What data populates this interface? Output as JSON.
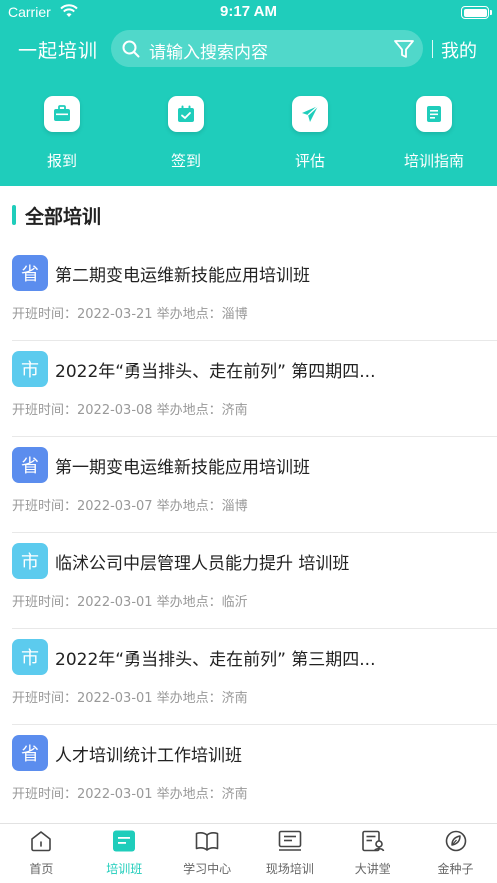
{
  "status_bar": {
    "carrier": "Carrier",
    "time": "9:17 AM"
  },
  "header": {
    "app_title": "一起培训",
    "search_placeholder": "请输入搜索内容",
    "mine_label": "我的"
  },
  "quick_actions": [
    {
      "label": "报到",
      "icon": "briefcase-icon"
    },
    {
      "label": "签到",
      "icon": "calendar-check-icon"
    },
    {
      "label": "评估",
      "icon": "paper-plane-icon"
    },
    {
      "label": "培训指南",
      "icon": "document-icon"
    }
  ],
  "section": {
    "title": "全部培训"
  },
  "trainings": [
    {
      "level": "省",
      "level_type": "province",
      "title": "第二期变电运维新技能应用培训班",
      "meta": "开班时间：2022-03-21 举办地点：淄博"
    },
    {
      "level": "市",
      "level_type": "city",
      "title": "2022年“勇当排头、走在前列” 第四期四...",
      "meta": "开班时间：2022-03-08 举办地点：济南"
    },
    {
      "level": "省",
      "level_type": "province",
      "title": "第一期变电运维新技能应用培训班",
      "meta": "开班时间：2022-03-07 举办地点：淄博"
    },
    {
      "level": "市",
      "level_type": "city",
      "title": "临沭公司中层管理人员能力提升 培训班",
      "meta": "开班时间：2022-03-01 举办地点：临沂"
    },
    {
      "level": "市",
      "level_type": "city",
      "title": "2022年“勇当排头、走在前列” 第三期四...",
      "meta": "开班时间：2022-03-01 举办地点：济南"
    },
    {
      "level": "省",
      "level_type": "province",
      "title": "人才培训统计工作培训班",
      "meta": "开班时间：2022-03-01 举办地点：济南"
    }
  ],
  "tabbar": {
    "active_index": 1,
    "tabs": [
      {
        "label": "首页",
        "icon": "home-icon"
      },
      {
        "label": "培训班",
        "icon": "training-class-icon"
      },
      {
        "label": "学习中心",
        "icon": "book-icon"
      },
      {
        "label": "现场培训",
        "icon": "onsite-training-icon"
      },
      {
        "label": "大讲堂",
        "icon": "lecture-icon"
      },
      {
        "label": "金种子",
        "icon": "seed-icon"
      }
    ]
  },
  "colors": {
    "accent": "#1fcdbb",
    "province_badge": "#5b8dee",
    "city_badge": "#5ccbee"
  }
}
